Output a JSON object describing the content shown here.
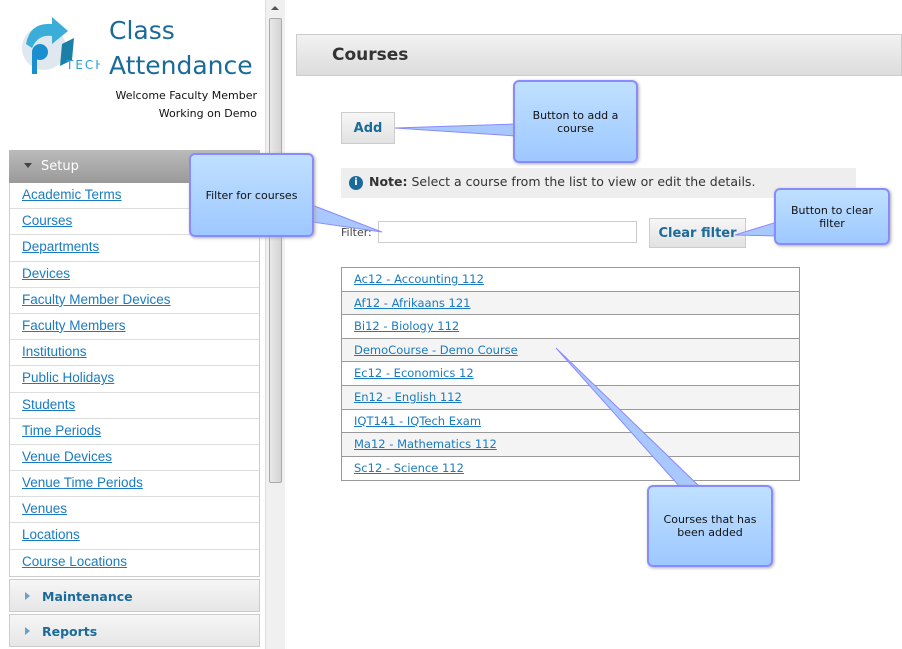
{
  "app": {
    "title_line1": "Class",
    "title_line2": "Attendance",
    "logo_text": "TECH",
    "welcome": "Welcome Faculty Member",
    "working_on": "Working on Demo"
  },
  "sidebar": {
    "setup": {
      "label": "Setup",
      "items": [
        "Academic Terms",
        "Courses",
        "Departments",
        "Devices",
        "Faculty Member Devices",
        "Faculty Members",
        "Institutions",
        "Public Holidays",
        "Students",
        "Time Periods",
        "Venue Devices",
        "Venue Time Periods",
        "Venues",
        "Locations",
        "Course Locations"
      ]
    },
    "maintenance": "Maintenance",
    "reports": "Reports"
  },
  "main": {
    "title": "Courses",
    "add_label": "Add",
    "note_bold": "Note:",
    "note_text": " Select a course from the list to view or edit the details.",
    "filter_label": "Filter:",
    "filter_value": "",
    "clear_filter_label": "Clear filter",
    "courses": [
      "Ac12 - Accounting 112",
      "Af12 - Afrikaans 121",
      "Bi12 - Biology 112",
      "DemoCourse - Demo Course",
      "Ec12 - Economics 12",
      "En12 - English 112",
      "IQT141 - IQTech Exam",
      "Ma12 - Mathematics 112",
      "Sc12 - Science 112"
    ]
  },
  "callouts": {
    "add": "Button to add a course",
    "filter": "Filter for courses",
    "clear": "Button to clear filter",
    "courses": "Courses that has been added"
  },
  "colors": {
    "accent": "#1a6a9a",
    "link": "#1a7bc0",
    "callout": "#a8d0ff"
  }
}
